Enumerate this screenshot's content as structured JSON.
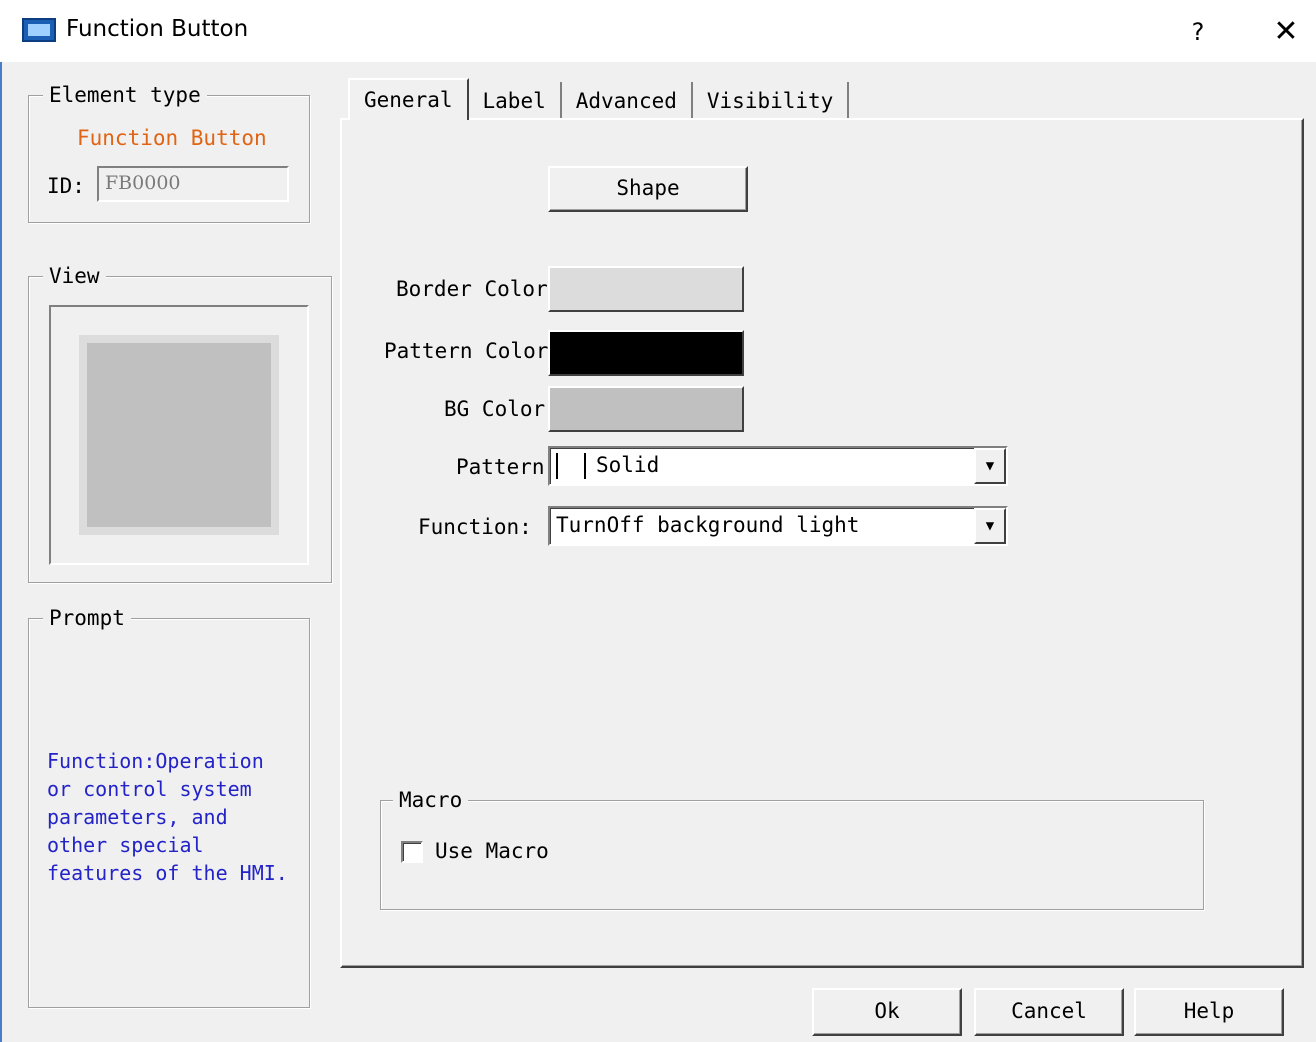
{
  "window": {
    "title": "Function Button",
    "help_glyph": "?",
    "close_glyph": "✕"
  },
  "element_type": {
    "legend": "Element type",
    "name": "Function Button",
    "id_label": "ID:",
    "id_value": "FB0000"
  },
  "view": {
    "legend": "View"
  },
  "prompt": {
    "legend": "Prompt",
    "text": "Function:Operation\nor control system\nparameters, and\nother special\nfeatures of the HMI."
  },
  "tabs": [
    {
      "label": "General",
      "active": true
    },
    {
      "label": "Label",
      "active": false
    },
    {
      "label": "Advanced",
      "active": false
    },
    {
      "label": "Visibility",
      "active": false
    }
  ],
  "general": {
    "shape_button": "Shape",
    "border_color_label": "Border Color",
    "pattern_color_label": "Pattern Color",
    "bg_color_label": "BG Color",
    "pattern_label": "Pattern:",
    "pattern_value": "Solid",
    "function_label": "Function:",
    "function_value": "TurnOff background light",
    "colors": {
      "border": "#dcdcdc",
      "pattern": "#000000",
      "bg": "#c0c0c0"
    }
  },
  "macro": {
    "legend": "Macro",
    "checkbox_label": "Use Macro",
    "checked": false
  },
  "buttons": {
    "ok": "Ok",
    "cancel": "Cancel",
    "help": "Help"
  },
  "icons": {
    "app": "hmi-app-icon",
    "dropdown": "chevron-down-icon"
  }
}
